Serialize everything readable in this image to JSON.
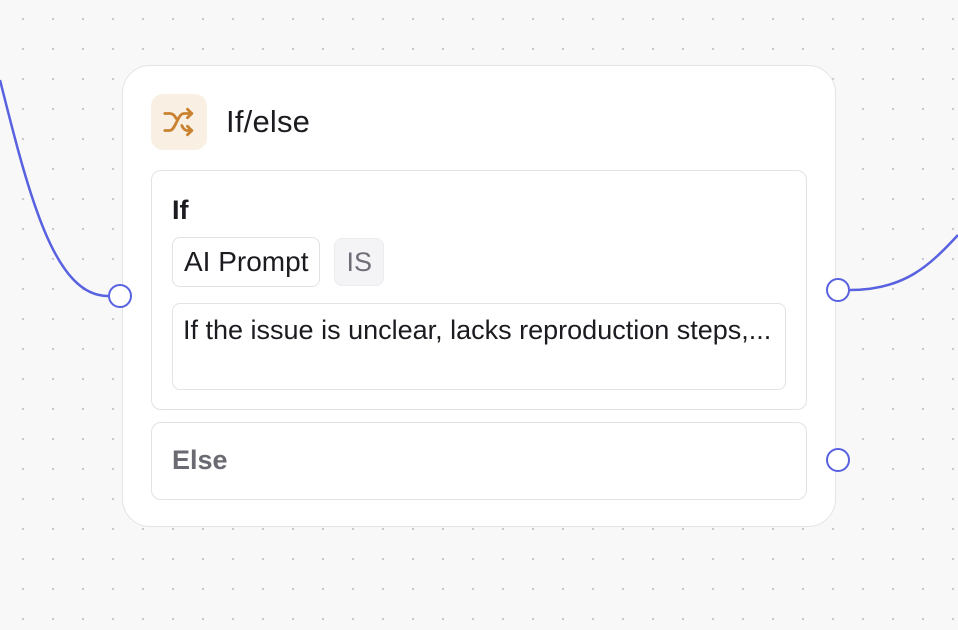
{
  "node": {
    "title": "If/else",
    "icon": "shuffle-icon",
    "icon_color": "#c9822f",
    "icon_background": "#f9efe3"
  },
  "if_branch": {
    "label": "If",
    "condition_source": "AI Prompt",
    "operator": "IS",
    "prompt_preview": "If the issue is unclear, lacks reproduction steps,..."
  },
  "else_branch": {
    "label": "Else"
  },
  "edges": {
    "color": "#5861e0"
  }
}
